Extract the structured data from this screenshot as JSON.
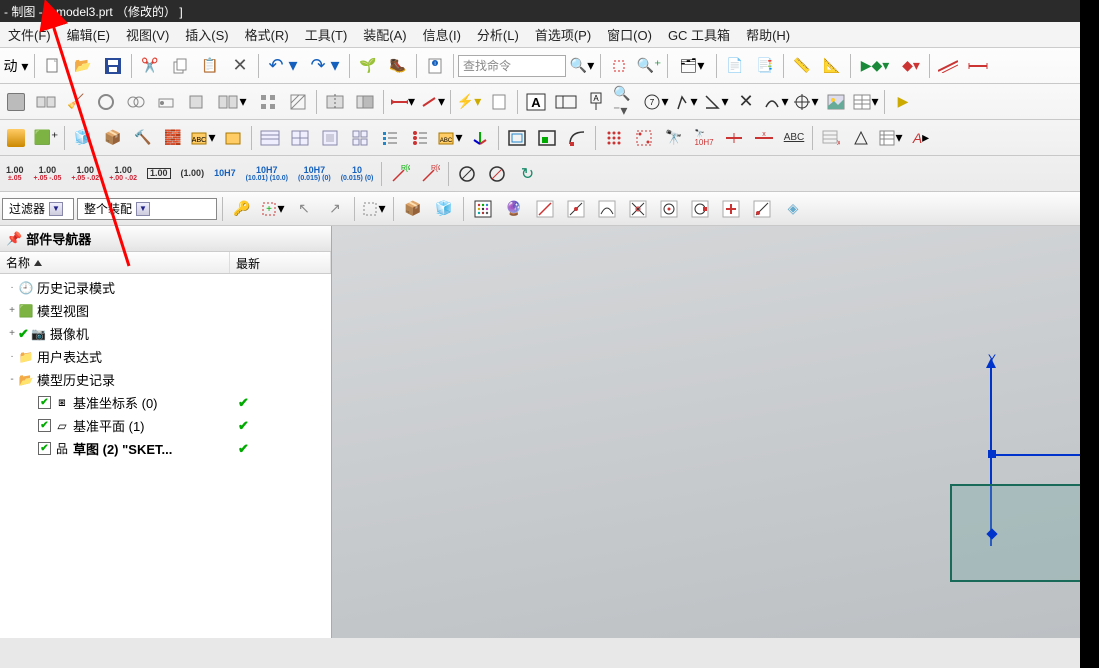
{
  "title": "- 制图 - [_model3.prt （修改的） ]",
  "menu": [
    "文件(F)",
    "编辑(E)",
    "视图(V)",
    "插入(S)",
    "格式(R)",
    "工具(T)",
    "装配(A)",
    "信息(I)",
    "分析(L)",
    "首选项(P)",
    "窗口(O)",
    "GC 工具箱",
    "帮助(H)"
  ],
  "search_placeholder": "查找命令",
  "filter_label": "过滤器",
  "assembly_scope": "整个装配",
  "panel_title": "部件导航器",
  "cols": {
    "name": "名称",
    "latest": "最新"
  },
  "tree": [
    {
      "label": "历史记录模式",
      "kind": "history",
      "indent": 0,
      "check": false,
      "greencheck": false,
      "latest": false,
      "exp": "·"
    },
    {
      "label": "模型视图",
      "kind": "modelview",
      "indent": 0,
      "check": false,
      "greencheck": false,
      "latest": false,
      "exp": "+"
    },
    {
      "label": "摄像机",
      "kind": "camera",
      "indent": 0,
      "check": false,
      "greencheck": true,
      "latest": false,
      "exp": "+"
    },
    {
      "label": "用户表达式",
      "kind": "userexpr",
      "indent": 0,
      "check": false,
      "greencheck": false,
      "latest": false,
      "exp": "·"
    },
    {
      "label": "模型历史记录",
      "kind": "modelhist",
      "indent": 0,
      "check": false,
      "greencheck": false,
      "latest": false,
      "exp": "-"
    },
    {
      "label": "基准坐标系 (0)",
      "kind": "datum-csys",
      "indent": 1,
      "check": true,
      "greencheck": false,
      "latest": true,
      "exp": ""
    },
    {
      "label": "基准平面 (1)",
      "kind": "datum-plane",
      "indent": 1,
      "check": true,
      "greencheck": false,
      "latest": true,
      "exp": ""
    },
    {
      "label": "草图 (2) \"SKET...",
      "kind": "sketch",
      "indent": 1,
      "check": true,
      "greencheck": false,
      "latest": true,
      "exp": "",
      "bold": true
    }
  ],
  "axis_label_y": "Y",
  "dim_row": [
    {
      "top": "1.00",
      "sub": "±.05",
      "cls": ""
    },
    {
      "top": "1.00",
      "sub": "+.05\n-.05",
      "cls": ""
    },
    {
      "top": "1.00",
      "sub": "+.05\n-.02",
      "cls": ""
    },
    {
      "top": "1.00",
      "sub": "+.00\n-.02",
      "cls": ""
    },
    {
      "top": "1.00",
      "sub": "",
      "cls": "box"
    },
    {
      "top": "1.00",
      "sub": "",
      "cls": "par"
    },
    {
      "top": "10H7",
      "sub": "",
      "cls": "blue"
    },
    {
      "top": "10H7",
      "sub": "(10.01)\n(10.0)",
      "cls": "blue"
    },
    {
      "top": "10H7",
      "sub": "(0.015)\n(0)",
      "cls": "blue"
    },
    {
      "top": "10",
      "sub": "(0.015)\n(0)",
      "cls": "blue"
    }
  ]
}
